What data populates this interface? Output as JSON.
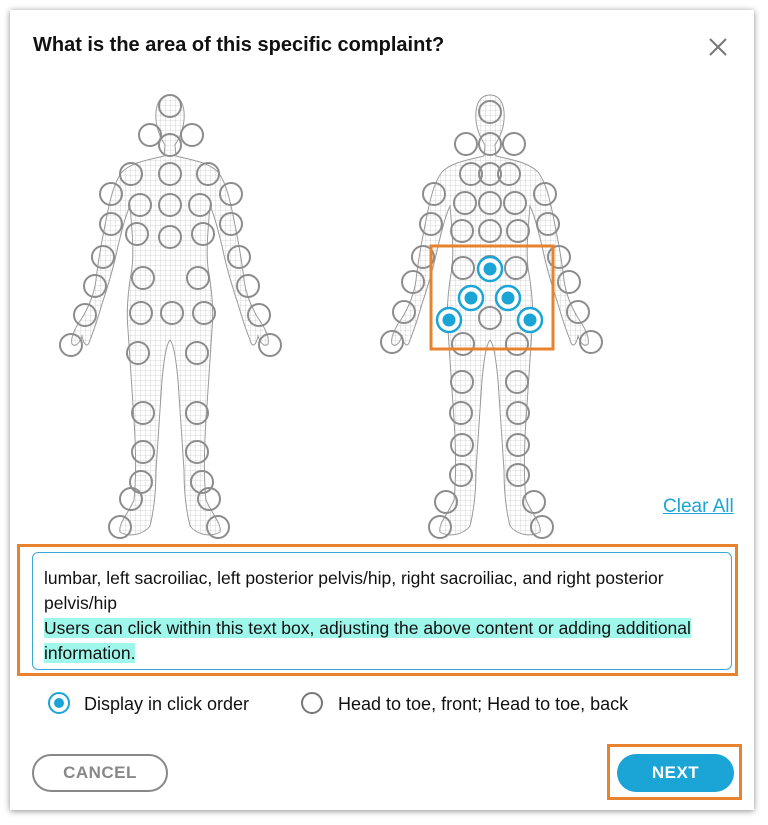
{
  "dialog": {
    "title": "What is the area of this specific complaint?",
    "close_icon": "close-icon"
  },
  "body_map": {
    "front_figure": "front-body-figure",
    "back_figure": "back-body-figure",
    "selected_count": 5,
    "selected_regions_icon": "selected-region-marker"
  },
  "clear_all_label": "Clear All",
  "textbox": {
    "content": "lumbar, left sacroiliac, left posterior pelvis/hip, right sacroiliac, and right posterior pelvis/hip",
    "annotation": "Users can click within this text box, adjusting the above content or adding additional information."
  },
  "sort_options": {
    "selected": "Display in click order",
    "option1": "Display in click order",
    "option2": "Head to toe, front; Head to toe, back"
  },
  "buttons": {
    "cancel": "CANCEL",
    "next": "NEXT"
  },
  "colors": {
    "accent": "#1ba4d6",
    "annotation_border": "#e8822e",
    "highlight": "#9ff6ea"
  }
}
